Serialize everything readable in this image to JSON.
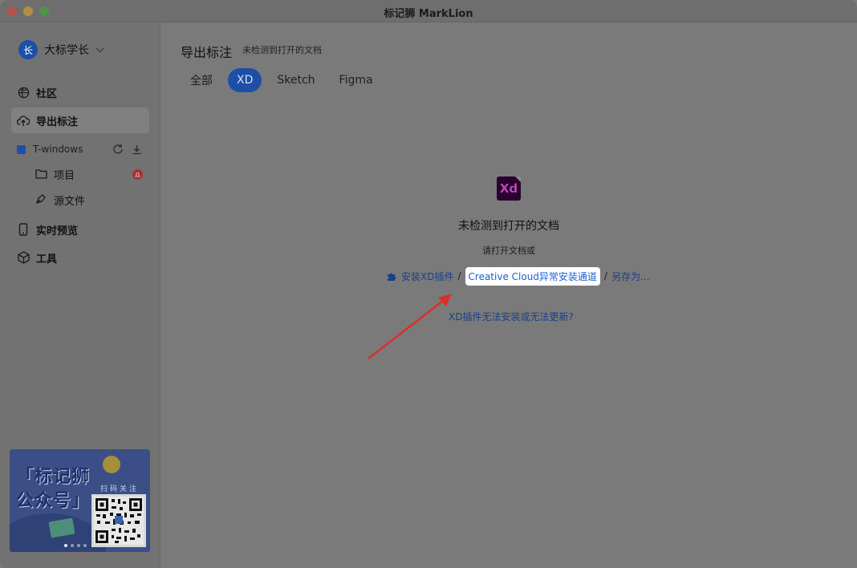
{
  "window": {
    "title": "标记狮 MarkLion"
  },
  "user": {
    "avatar_text": "长",
    "name": "大标学长"
  },
  "nav": {
    "community": "社区",
    "export": "导出标注",
    "live_preview": "实时预览",
    "tools": "工具"
  },
  "workspace": {
    "name": "T-windows",
    "projects": "项目",
    "source_files": "源文件"
  },
  "banner": {
    "line1": "「标记狮",
    "line2": "公众号」",
    "scan_text": "扫码关注"
  },
  "main": {
    "title": "导出标注",
    "subtitle": "未检测到打开的文档",
    "tabs": [
      "全部",
      "XD",
      "Sketch",
      "Figma"
    ],
    "active_tab": "XD",
    "logo_text": "Xd",
    "empty_title": "未检测到打开的文档",
    "empty_hint": "请打开文档或",
    "install_plugin": "安装XD插件",
    "creative_cloud": "Creative Cloud异常安装通道",
    "save_as": "另存为...",
    "help": "XD插件无法安装或无法更新?"
  },
  "colors": {
    "accent": "#1d4fa8",
    "link": "#1e5fd2",
    "arrow": "#d9302a"
  }
}
